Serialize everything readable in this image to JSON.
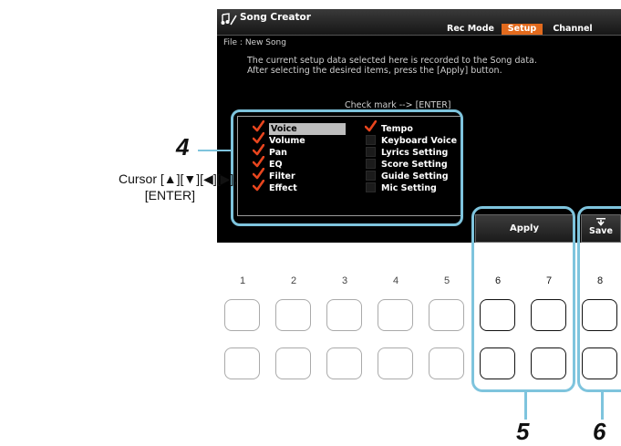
{
  "window": {
    "title": "Song Creator",
    "tabs": [
      "Rec Mode",
      "Setup",
      "Channel"
    ],
    "active_tab": "Setup",
    "accent_color": "#e26a1d"
  },
  "file_line": "File : New Song",
  "description": "The current setup data selected here is recorded to the Song data.\nAfter selecting the desired items, press the [Apply] button.",
  "check_hint": "Check mark --> [ENTER]",
  "items_left": [
    {
      "label": "Voice",
      "checked": true,
      "selected": true
    },
    {
      "label": "Volume",
      "checked": true
    },
    {
      "label": "Pan",
      "checked": true
    },
    {
      "label": "EQ",
      "checked": true
    },
    {
      "label": "Filter",
      "checked": true
    },
    {
      "label": "Effect",
      "checked": true
    }
  ],
  "items_right": [
    {
      "label": "Tempo",
      "checked": true
    },
    {
      "label": "Keyboard Voice",
      "checked": false
    },
    {
      "label": "Lyrics Setting",
      "checked": false
    },
    {
      "label": "Score Setting",
      "checked": false
    },
    {
      "label": "Guide Setting",
      "checked": false
    },
    {
      "label": "Mic Setting",
      "checked": false
    }
  ],
  "apply_label": "Apply",
  "save_label": "Save",
  "callout": {
    "number": "4",
    "lines": [
      "Cursor [▲][▼][◀][▶],",
      "[ENTER]"
    ]
  },
  "columns": [
    "1",
    "2",
    "3",
    "4",
    "5",
    "6",
    "7",
    "8"
  ],
  "steps": [
    "5",
    "6"
  ]
}
